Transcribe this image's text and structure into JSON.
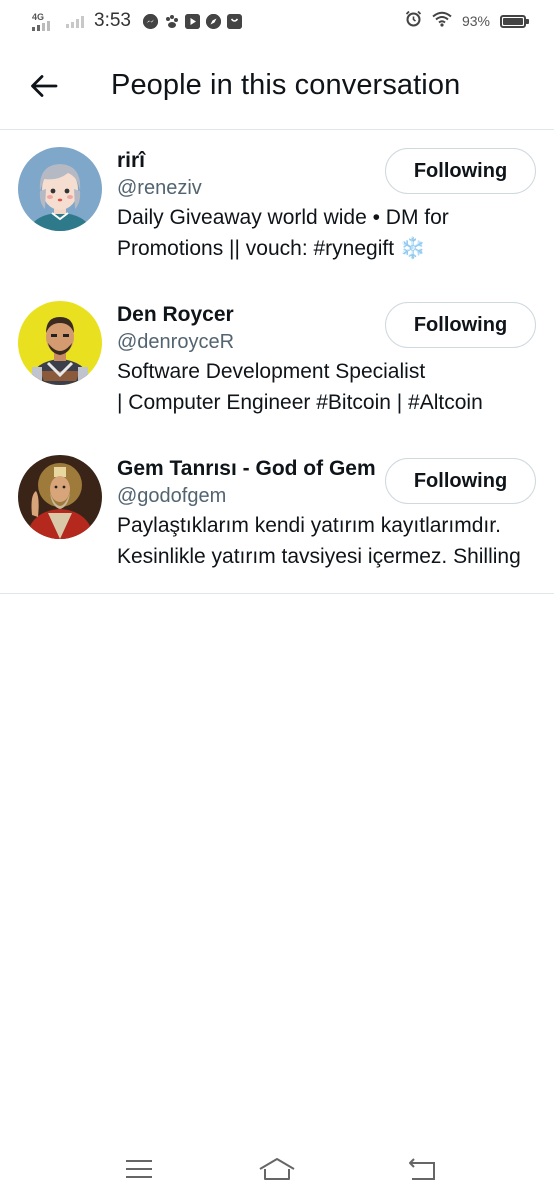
{
  "status_bar": {
    "network": "4G",
    "time": "3:53",
    "battery_percent": "93%",
    "battery_level": 0.93,
    "app_icons": [
      "messenger-icon",
      "paw-app-icon",
      "youtube-icon",
      "compass-icon",
      "bag-icon"
    ],
    "system_icons": [
      "alarm-icon",
      "wifi-icon",
      "battery-icon"
    ]
  },
  "header": {
    "title": "People in this conversation",
    "back_icon": "arrow-left-icon"
  },
  "people": [
    {
      "display_name": "rirî",
      "handle": "@reneziv",
      "bio_lines": [
        "Daily Giveaway world wide • DM for",
        "Promotions || vouch: #rynegift"
      ],
      "bio_emoji": "❄️",
      "follow_label": "Following"
    },
    {
      "display_name": "Den Roycer",
      "handle": "@denroyceR",
      "bio_lines": [
        "Software Development Specialist",
        "| Computer Engineer #Bitcoin | #Altcoin"
      ],
      "follow_label": "Following"
    },
    {
      "display_name": "Gem Tanrısı - God of Gem",
      "handle": "@godofgem",
      "bio_lines": [
        "Paylaştıklarım kendi yatırım kayıtlarımdır.",
        "Kesinlikle yatırım tavsiyesi içermez. Shilling"
      ],
      "follow_label": "Following"
    }
  ],
  "nav_bar": {
    "items": [
      "menu-icon",
      "home-icon",
      "back-icon"
    ]
  },
  "colors": {
    "text_primary": "#0f1419",
    "text_secondary": "#536471",
    "divider": "#e1e6ea",
    "button_border": "#cfd9de",
    "avatar1_bg": "#7fa7c9",
    "avatar2_bg": "#e9e11f",
    "avatar3_bg": "#6b2a1a"
  }
}
